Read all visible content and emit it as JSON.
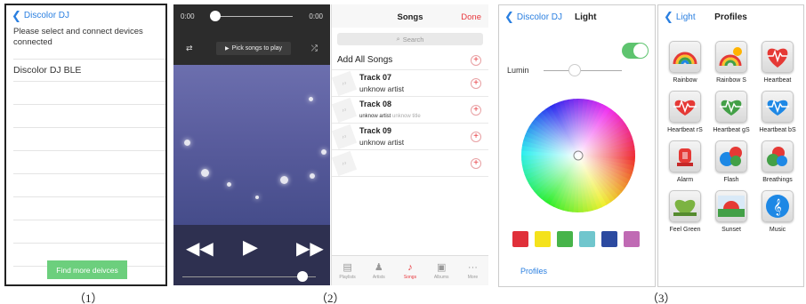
{
  "captions": [
    "（1）",
    "（2）",
    "（3）"
  ],
  "panel1": {
    "back_label": "Discolor DJ",
    "message": "Please select and connect devices connected",
    "devices": [
      "Discolor DJ BLE"
    ],
    "find_button": "Find more deivces"
  },
  "player": {
    "time_start": "0:00",
    "time_end": "0:00",
    "pick_label": "Pick songs to play",
    "progress_fraction": 0.05,
    "volume_fraction": 0.9
  },
  "songs": {
    "title": "Songs",
    "done": "Done",
    "search_placeholder": "Search",
    "add_all": "Add All Songs",
    "items": [
      {
        "title": "Track 07",
        "artist": "unknow artist",
        "extra": ""
      },
      {
        "title": "Track 08",
        "artist": "unknow artist",
        "extra": "unknow title"
      },
      {
        "title": "Track 09",
        "artist": "unknow artist",
        "extra": ""
      }
    ],
    "tabs": [
      "Playlists",
      "Artists",
      "Songs",
      "Albums",
      "More"
    ],
    "active_tab": "Songs"
  },
  "light": {
    "back_label": "Discolor DJ",
    "title": "Light",
    "lumin_label": "Lumin",
    "lumin_fraction": 0.4,
    "power_on": true,
    "swatches": [
      "#e0303a",
      "#f4e21c",
      "#47b44a",
      "#70c6cd",
      "#2c4aa0",
      "#c06ab4"
    ],
    "profiles_link": "Profiles"
  },
  "profiles": {
    "back_label": "Light",
    "title": "Profiles",
    "items": [
      {
        "label": "Rainbow",
        "icon": "rainbow-icon"
      },
      {
        "label": "Rainbow S",
        "icon": "rainbow-sun-icon"
      },
      {
        "label": "Heartbeat",
        "icon": "heartbeat-icon"
      },
      {
        "label": "Heartbeat rS",
        "icon": "heartbeat-red-icon"
      },
      {
        "label": "Heartbeat gS",
        "icon": "heartbeat-green-icon"
      },
      {
        "label": "Heartbeat bS",
        "icon": "heartbeat-blue-icon"
      },
      {
        "label": "Alarm",
        "icon": "alarm-icon"
      },
      {
        "label": "Flash",
        "icon": "flash-icon"
      },
      {
        "label": "Breathings",
        "icon": "breathing-icon"
      },
      {
        "label": "Feel Green",
        "icon": "feel-green-icon"
      },
      {
        "label": "Sunset",
        "icon": "sunset-icon"
      },
      {
        "label": "Music",
        "icon": "music-icon"
      }
    ]
  }
}
